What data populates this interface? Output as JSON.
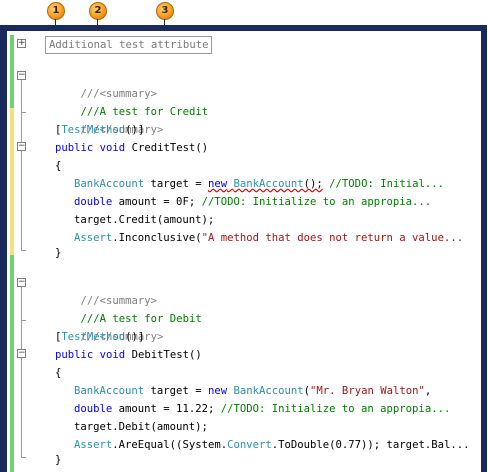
{
  "callouts": [
    "1",
    "2",
    "3"
  ],
  "collapsed_region": "Additional test attribute",
  "code": {
    "credit_summary_open": "///<summary>",
    "credit_summary_text": "///A test for Credit",
    "credit_summary_close": "///</summary>",
    "test_method_attr": "TestMethod",
    "credit_public": "public",
    "credit_void": "void",
    "credit_name": " CreditTest()",
    "open_brace": "{",
    "close_brace": "}",
    "credit_l1_type": "BankAccount",
    "credit_l1_mid": " target = ",
    "credit_l1_new": "new",
    "credit_l1_ctor": "BankAccount",
    "credit_l1_parens": "();",
    "credit_l1_comment": " //TODO: Initial...",
    "credit_l2_kw": "double",
    "credit_l2_mid": " amount = 0F; ",
    "credit_l2_comment": "//TODO: Initialize to an appropia...",
    "credit_l3": "target.Credit(amount);",
    "credit_l4_type": "Assert",
    "credit_l4_mid": ".Inconclusive(",
    "credit_l4_str": "\"A method that does not return a value...",
    "debit_summary_open": "///<summary>",
    "debit_summary_text": "///A test for Debit",
    "debit_summary_close": "///</summary>",
    "debit_public": "public",
    "debit_void": "void",
    "debit_name": " DebitTest()",
    "debit_l1_type": "BankAccount",
    "debit_l1_mid": " target = ",
    "debit_l1_new": "new",
    "debit_l1_ctor": "BankAccount",
    "debit_l1_open": "(",
    "debit_l1_str": "\"Mr. Bryan Walton\"",
    "debit_l1_close": ",",
    "debit_l2_kw": "double",
    "debit_l2_mid": " amount = 11.22; ",
    "debit_l2_comment": "//TODO: Initialize to an appropia...",
    "debit_l3": "target.Debit(amount);",
    "debit_l4_type": "Assert",
    "debit_l4_a": ".AreEqual((System.",
    "debit_l4_convert": "Convert",
    "debit_l4_b": ".ToDouble(0.77)); target.Bal..."
  },
  "colors": {
    "frame": "#1a2a5c",
    "callout": "#f39a1a",
    "changed_saved": "#6fd16f",
    "changed_unsaved": "#f3e27a",
    "comment": "#008000",
    "keyword": "#0000ff",
    "type": "#2b91af",
    "string": "#a31515"
  }
}
